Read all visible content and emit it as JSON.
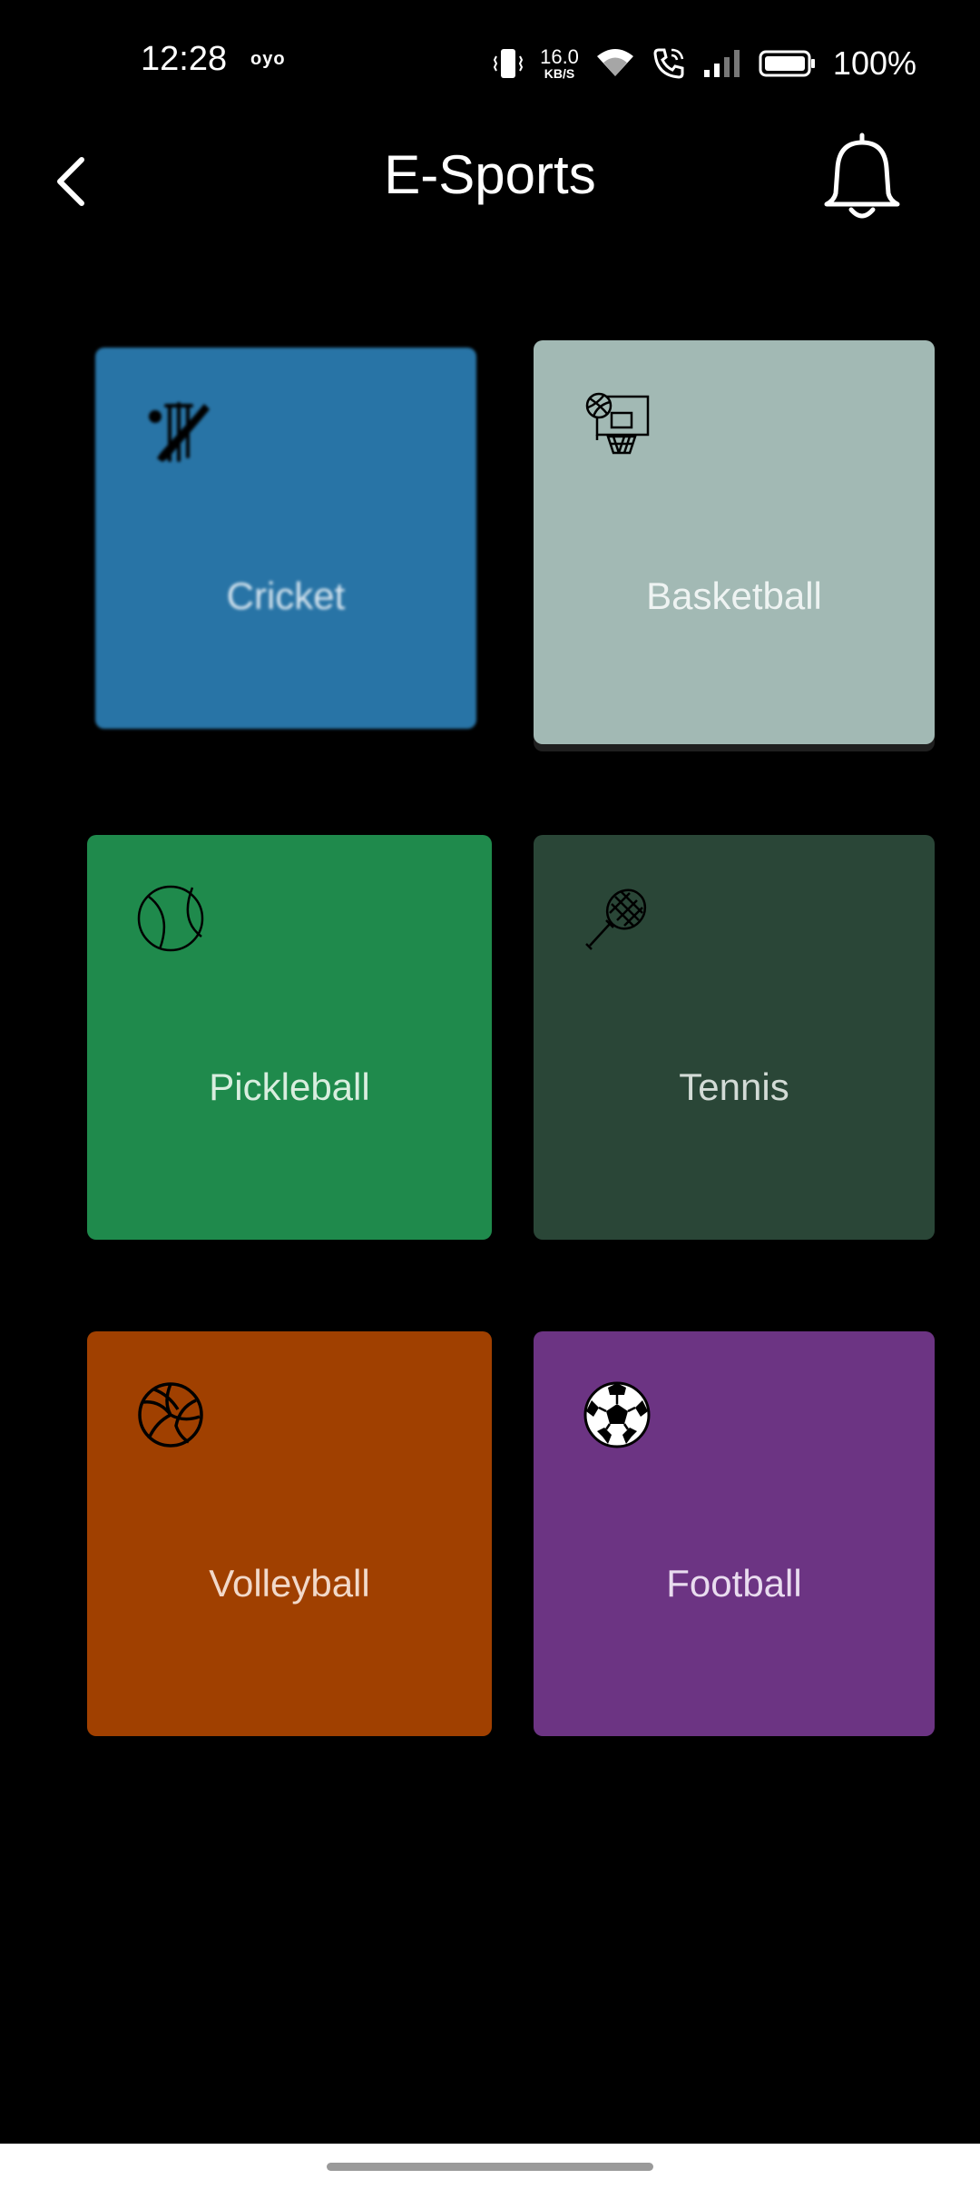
{
  "status_bar": {
    "time": "12:28",
    "carrier": "oyo",
    "net_speed": "16.0",
    "net_unit": "KB/S",
    "battery": "100%",
    "icons": [
      "vibrate-icon",
      "wifi-icon",
      "call-icon",
      "signal-icon",
      "battery-icon"
    ]
  },
  "header": {
    "title": "E-Sports",
    "back_icon": "chevron-left-icon",
    "notification_icon": "bell-icon"
  },
  "sports": [
    {
      "label": "Cricket",
      "icon": "cricket-icon",
      "color": "#2874A6",
      "text_color": "#d8e6f0"
    },
    {
      "label": "Basketball",
      "icon": "basketball-icon",
      "color": "#A2B9B4",
      "text_color": "#eef3f2"
    },
    {
      "label": "Pickleball",
      "icon": "pickleball-icon",
      "color": "#1F8A4C",
      "text_color": "#d9eedf"
    },
    {
      "label": "Tennis",
      "icon": "tennis-icon",
      "color": "#2A4637",
      "text_color": "#d3dbd6"
    },
    {
      "label": "Volleyball",
      "icon": "volleyball-icon",
      "color": "#A04000",
      "text_color": "#f2d9c9"
    },
    {
      "label": "Football",
      "icon": "football-icon",
      "color": "#6C3483",
      "text_color": "#e9dcef"
    }
  ]
}
